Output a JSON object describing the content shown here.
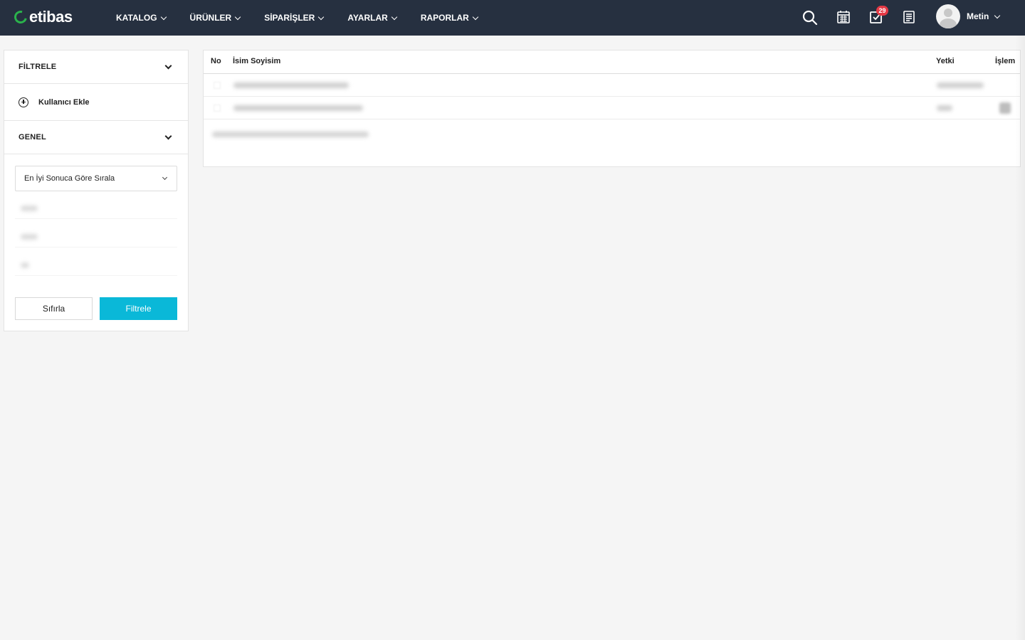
{
  "brand": {
    "name": "etibas",
    "accent_color": "#2bb24c"
  },
  "nav": {
    "items": [
      {
        "label": "KATALOG"
      },
      {
        "label": "ÜRÜNLER"
      },
      {
        "label": "SİPARİŞLER"
      },
      {
        "label": "AYARLAR"
      },
      {
        "label": "RAPORLAR"
      }
    ],
    "icons": [
      "search-icon",
      "calendar-icon",
      "task-check-icon",
      "document-list-icon"
    ],
    "tasks_badge": "29",
    "user_name": "Metin"
  },
  "sidebar": {
    "filter_title": "FİLTRELE",
    "add_user_label": "Kullanıcı Ekle",
    "general_title": "GENEL",
    "sort_select": {
      "selected": "En İyi Sonuca Göre Sırala"
    },
    "reset_label": "Sıfırla",
    "filter_label": "Filtrele",
    "filter_button_color": "#0ab8d8"
  },
  "table": {
    "columns": [
      "No",
      "İsim Soyisim",
      "Yetki",
      "İşlem"
    ]
  }
}
